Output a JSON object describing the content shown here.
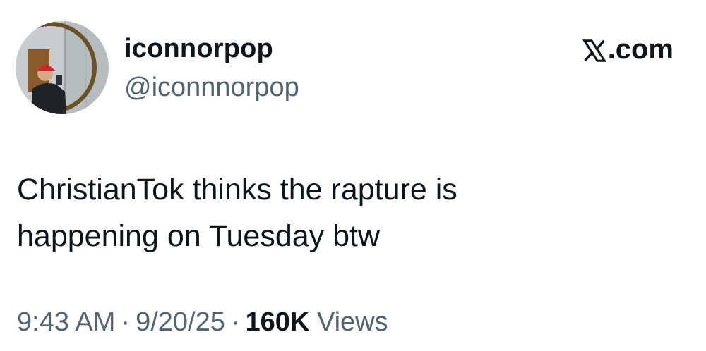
{
  "user": {
    "display_name": "iconnorpop",
    "handle": "@iconnnorpop",
    "avatar_icon": "profile-photo-avatar"
  },
  "brand": {
    "label": ".com",
    "icon": "x-logo-icon"
  },
  "tweet": {
    "line1": "ChristianTok thinks the rapture is",
    "line2": "happening on Tuesday btw"
  },
  "meta": {
    "time": "9:43 AM",
    "separator": "·",
    "date": "9/20/25",
    "views_count": "160K",
    "views_label": "Views"
  },
  "colors": {
    "text_primary": "#0f1419",
    "text_secondary": "#536471",
    "background": "#ffffff"
  }
}
